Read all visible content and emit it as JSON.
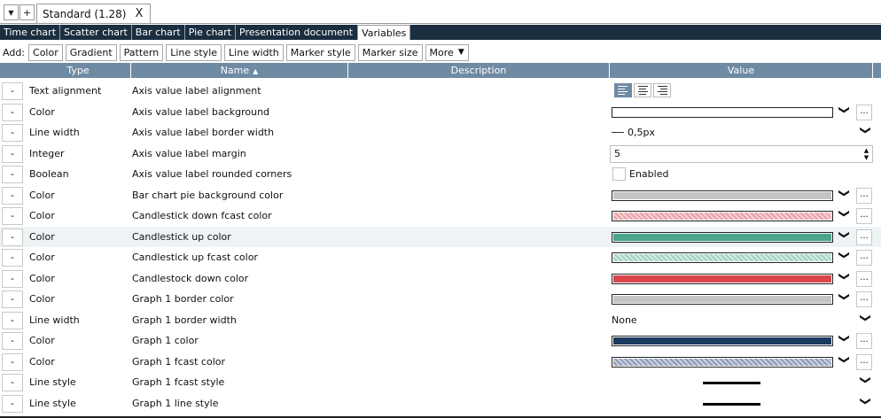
{
  "tabs": {
    "dropdown_glyph": "▼",
    "add_glyph": "+",
    "doc_label": "Standard (1.28)",
    "close_glyph": "X"
  },
  "subtabs": [
    {
      "label": "Time chart"
    },
    {
      "label": "Scatter chart"
    },
    {
      "label": "Bar chart"
    },
    {
      "label": "Pie chart"
    },
    {
      "label": "Presentation document"
    },
    {
      "label": "Variables",
      "active": true
    }
  ],
  "addbar": {
    "label": "Add:",
    "buttons": [
      "Color",
      "Gradient",
      "Pattern",
      "Line style",
      "Line width",
      "Marker style",
      "Marker size"
    ],
    "more_label": "More",
    "more_glyph": "▼"
  },
  "table": {
    "headers": {
      "type": "Type",
      "name": "Name",
      "name_sort_glyph": "▲",
      "description": "Description",
      "value": "Value"
    },
    "remove_glyph": "-",
    "dropdown_glyph": "❯",
    "dots_glyph": "...",
    "rows": [
      {
        "type": "Text alignment",
        "name": "Axis value label alignment",
        "kind": "align"
      },
      {
        "type": "Color",
        "name": "Axis value label background",
        "kind": "color",
        "color": "#ffffff",
        "hatched": false
      },
      {
        "type": "Line width",
        "name": "Axis value label border width",
        "kind": "select",
        "text": "0,5px",
        "icon": "thin-line"
      },
      {
        "type": "Integer",
        "name": "Axis value label margin",
        "kind": "number",
        "text": "5"
      },
      {
        "type": "Boolean",
        "name": "Axis value label rounded corners",
        "kind": "check",
        "text": "Enabled"
      },
      {
        "type": "Color",
        "name": "Bar chart pie background color",
        "kind": "color",
        "color": "#c4c4c4",
        "hatched": false
      },
      {
        "type": "Color",
        "name": "Candlestick down fcast color",
        "kind": "color",
        "color": "#e8a0a4",
        "hatched": true
      },
      {
        "type": "Color",
        "name": "Candlestick up color",
        "kind": "color",
        "color": "#4aa58c",
        "hatched": false,
        "highlight": true
      },
      {
        "type": "Color",
        "name": "Candlestick up fcast color",
        "kind": "color",
        "color": "#9fd3c2",
        "hatched": true
      },
      {
        "type": "Color",
        "name": "Candlestock down color",
        "kind": "color",
        "color": "#d9454b",
        "hatched": false
      },
      {
        "type": "Color",
        "name": "Graph 1 border color",
        "kind": "color",
        "color": "#c4c4c4",
        "hatched": false
      },
      {
        "type": "Line width",
        "name": "Graph 1 border width",
        "kind": "select",
        "text": "None"
      },
      {
        "type": "Color",
        "name": "Graph 1 color",
        "kind": "color",
        "color": "#1b3a5f",
        "hatched": false
      },
      {
        "type": "Color",
        "name": "Graph 1 fcast color",
        "kind": "color",
        "color": "#8d9bb6",
        "hatched": true
      },
      {
        "type": "Line style",
        "name": "Graph 1 fcast style",
        "kind": "linestyle"
      },
      {
        "type": "Line style",
        "name": "Graph 1 line style",
        "kind": "linestyle"
      }
    ]
  }
}
